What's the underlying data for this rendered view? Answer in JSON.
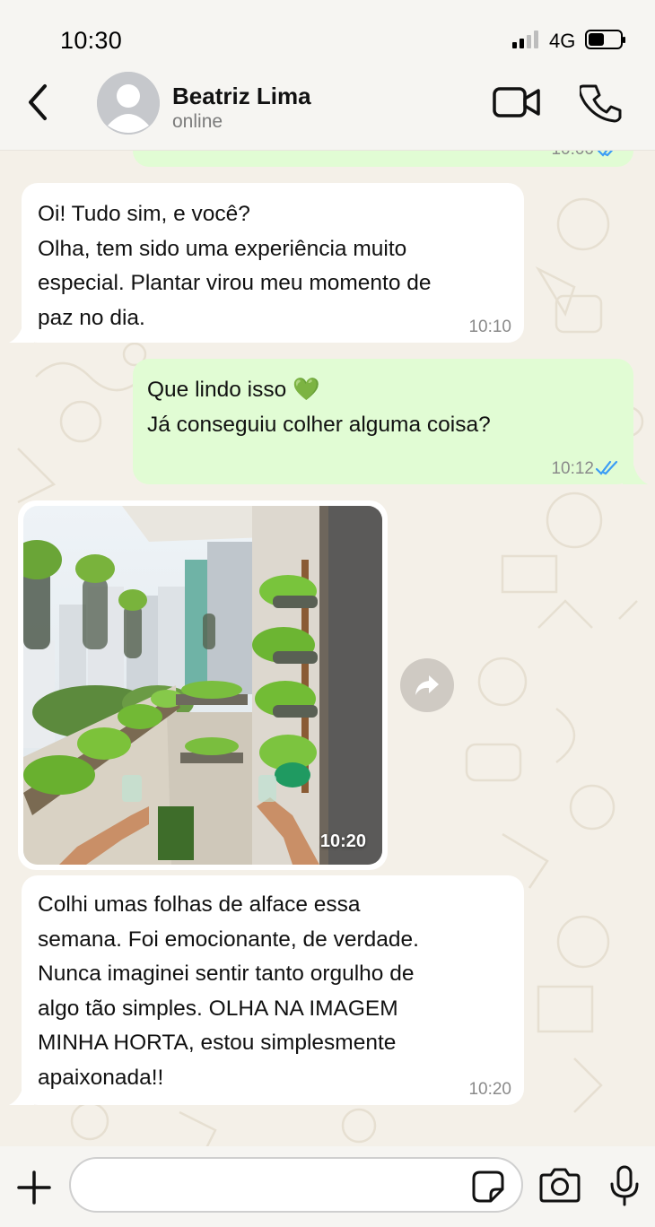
{
  "status_bar": {
    "time": "10:30",
    "network": "4G"
  },
  "header": {
    "contact_name": "Beatriz Lima",
    "contact_status": "online"
  },
  "messages": [
    {
      "type": "partial-out",
      "time": "10:00"
    },
    {
      "type": "in",
      "lines": [
        "Oi! Tudo sim, e você?",
        "Olha, tem sido uma experiência muito",
        "especial. Plantar virou meu momento de",
        "paz no dia."
      ],
      "time": "10:10"
    },
    {
      "type": "out",
      "lines": [
        "Que lindo isso 💚",
        "Já conseguiu colher alguma coisa?"
      ],
      "time": "10:12",
      "status": "read"
    },
    {
      "type": "image-in",
      "time": "10:20"
    },
    {
      "type": "in",
      "lines": [
        "Colhi umas folhas de alface essa",
        "semana. Foi emocionante, de verdade.",
        "Nunca imaginei sentir tanto orgulho de",
        "algo tão simples. OLHA NA IMAGEM",
        "MINHA HORTA, estou simplesmente",
        "apaixonada!!"
      ],
      "time": "10:20"
    }
  ],
  "input": {
    "placeholder": ""
  },
  "icons": {
    "back": "chevron-left-icon",
    "avatar": "person-icon",
    "video": "video-camera-icon",
    "call": "phone-icon",
    "forward": "forward-icon",
    "plus": "plus-icon",
    "sticker": "sticker-icon",
    "camera": "camera-icon",
    "mic": "microphone-icon"
  },
  "colors": {
    "incoming": "#ffffff",
    "outgoing": "#e1fcd4",
    "read_ticks": "#3b9cf5",
    "background": "#f4f0e8"
  }
}
